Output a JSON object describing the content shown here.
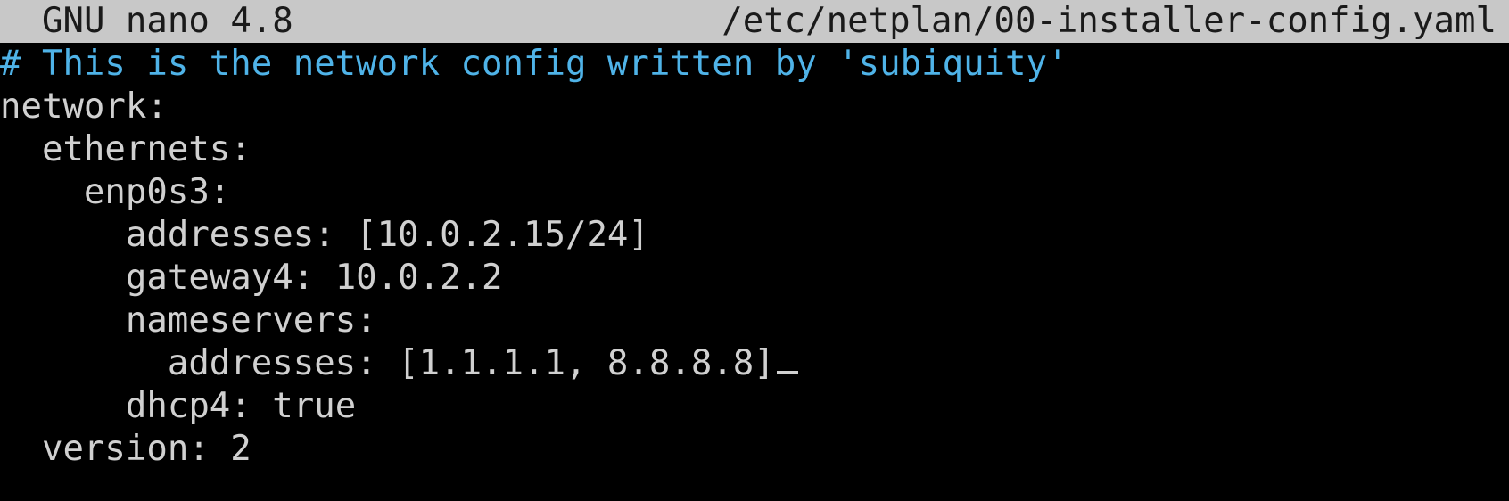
{
  "titlebar": {
    "app_version": "GNU nano 4.8",
    "file_path": "/etc/netplan/00-installer-config.yaml"
  },
  "editor": {
    "lines": [
      {
        "indent": "",
        "text": "# This is the network config written by 'subiquity'",
        "kind": "comment"
      },
      {
        "indent": "",
        "text": "network:",
        "kind": "code"
      },
      {
        "indent": "  ",
        "text": "ethernets:",
        "kind": "code"
      },
      {
        "indent": "    ",
        "text": "enp0s3:",
        "kind": "code"
      },
      {
        "indent": "      ",
        "text": "addresses: [10.0.2.15/24]",
        "kind": "code"
      },
      {
        "indent": "      ",
        "text": "gateway4: 10.0.2.2",
        "kind": "code"
      },
      {
        "indent": "      ",
        "text": "nameservers:",
        "kind": "code"
      },
      {
        "indent": "        ",
        "text": "addresses: [1.1.1.1, 8.8.8.8]",
        "kind": "code",
        "cursor": true
      },
      {
        "indent": "      ",
        "text": "dhcp4: true",
        "kind": "code"
      },
      {
        "indent": "  ",
        "text": "version: 2",
        "kind": "code"
      }
    ]
  },
  "colors": {
    "background": "#000000",
    "foreground": "#d0d0d0",
    "titlebar_bg": "#c8c8c8",
    "comment": "#4fb3e8"
  }
}
